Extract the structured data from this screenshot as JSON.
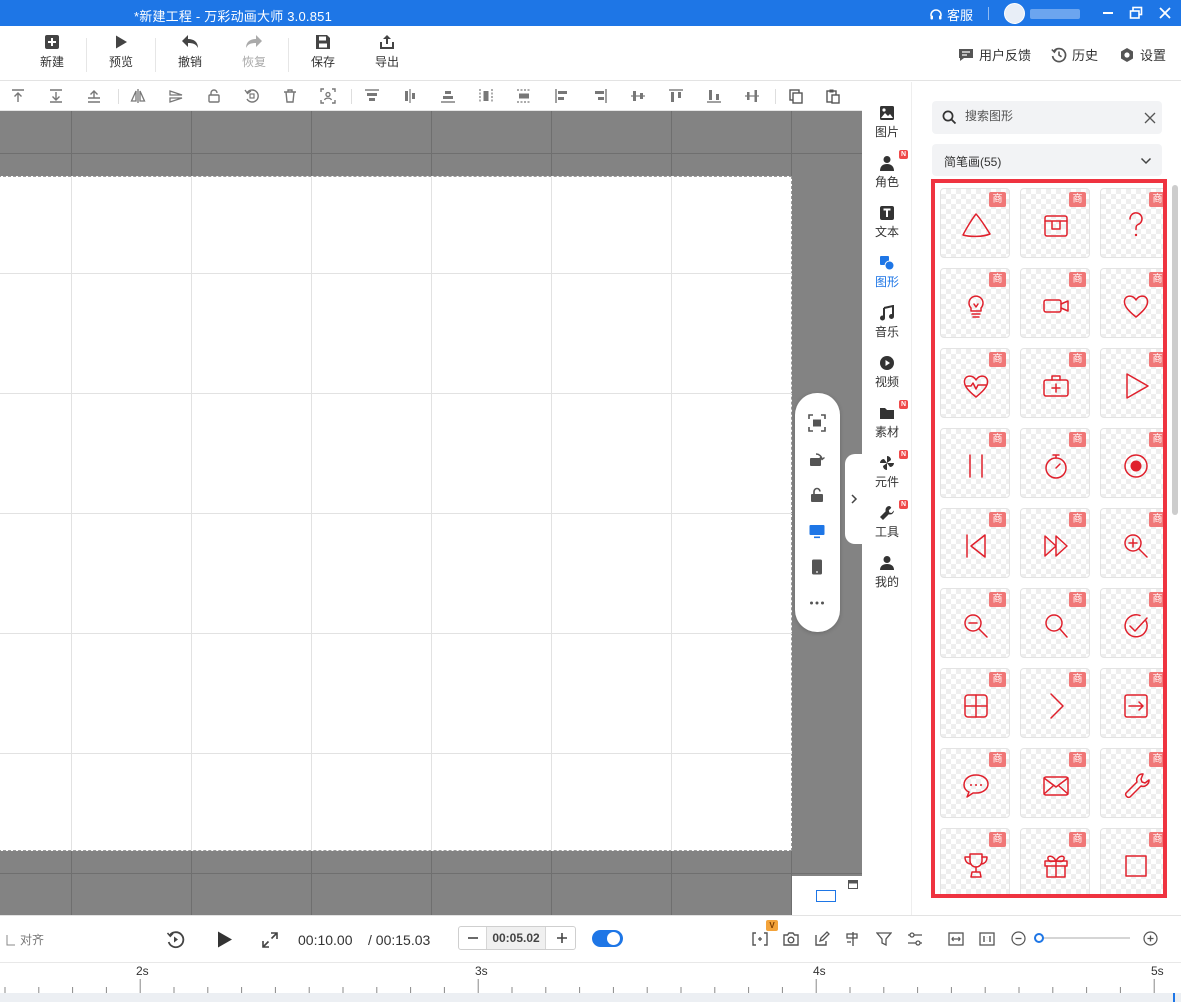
{
  "window": {
    "title": "*新建工程 - 万彩动画大师 3.0.851",
    "service_label": "客服"
  },
  "toolbar": {
    "items": [
      {
        "label": "新建",
        "icon": "plus-square-icon"
      },
      {
        "label": "预览",
        "icon": "play-icon"
      },
      {
        "label": "撤销",
        "icon": "undo-icon"
      },
      {
        "label": "恢复",
        "icon": "redo-icon"
      },
      {
        "label": "保存",
        "icon": "save-icon"
      },
      {
        "label": "导出",
        "icon": "export-icon"
      }
    ],
    "right": [
      {
        "label": "用户反馈",
        "icon": "feedback-icon"
      },
      {
        "label": "历史",
        "icon": "history-icon"
      },
      {
        "label": "设置",
        "icon": "gear-icon"
      }
    ]
  },
  "sidenav": {
    "items": [
      {
        "label": "图片",
        "icon": "image-icon",
        "badge": ""
      },
      {
        "label": "角色",
        "icon": "person-icon",
        "badge": "N"
      },
      {
        "label": "文本",
        "icon": "text-icon",
        "badge": ""
      },
      {
        "label": "图形",
        "icon": "shape-icon",
        "badge": ""
      },
      {
        "label": "音乐",
        "icon": "music-icon",
        "badge": ""
      },
      {
        "label": "视频",
        "icon": "video-icon",
        "badge": ""
      },
      {
        "label": "素材",
        "icon": "folder-icon",
        "badge": "N"
      },
      {
        "label": "元件",
        "icon": "pinwheel-icon",
        "badge": "N"
      },
      {
        "label": "工具",
        "icon": "wrench-icon",
        "badge": "N"
      },
      {
        "label": "我的",
        "icon": "user-icon",
        "badge": ""
      }
    ],
    "active": "图形"
  },
  "panel": {
    "search_placeholder": "搜索图形",
    "category": "简笔画(55)",
    "tag": "商",
    "shapes": [
      "triangle",
      "package",
      "question-mark",
      "lightbulb",
      "video-camera",
      "heart",
      "heart-pulse",
      "first-aid-kit",
      "play-triangle",
      "pause-bars",
      "stopwatch",
      "record-dot",
      "skip-back",
      "fast-forward",
      "zoom-in",
      "zoom-out",
      "magnifier",
      "check-circle",
      "grid-window",
      "chevron-right",
      "sign-in-box",
      "chat-bubble",
      "envelope",
      "wrench",
      "trophy",
      "gift",
      "square"
    ]
  },
  "timeline": {
    "align_label": "对齐",
    "current_time": "00:10.00",
    "total_time": "/ 00:15.03",
    "zoom_time": "00:05.02",
    "ruler_labels": [
      "2s",
      "3s",
      "4s",
      "5s"
    ],
    "v_badge": "V"
  },
  "colors": {
    "accent": "#1e76e6",
    "highlight_border": "#ef3340",
    "shape_stroke": "#e0202c",
    "tag_bg": "#f07878"
  }
}
